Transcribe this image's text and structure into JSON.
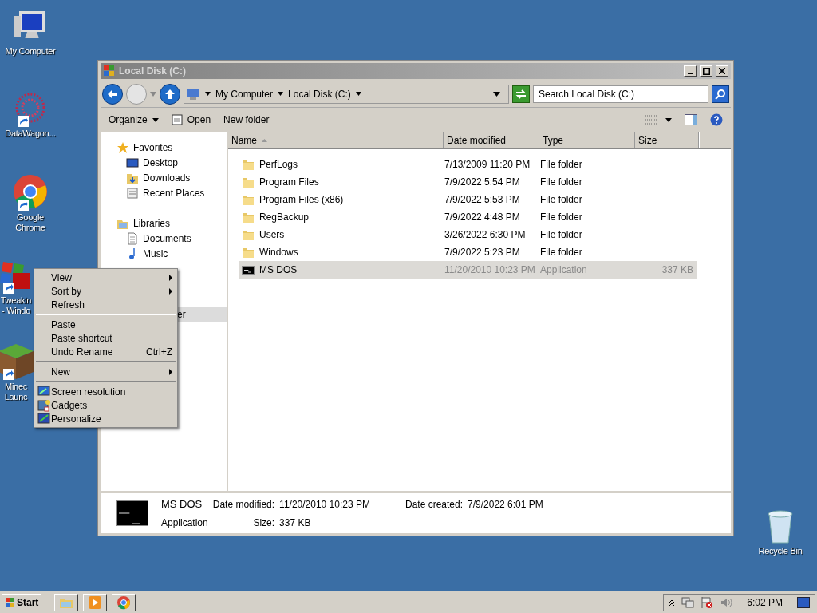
{
  "desktop_icons": [
    {
      "label": "My Computer",
      "kind": "computer",
      "shortcut": false
    },
    {
      "label": "DataWagon...",
      "kind": "datawagon",
      "shortcut": true
    },
    {
      "label": "Google Chrome",
      "kind": "chrome",
      "shortcut": true
    },
    {
      "label": "Tweakin\n- Windo",
      "kind": "tweaking",
      "shortcut": true
    },
    {
      "label": "Minec\nLaunc",
      "kind": "minecraft",
      "shortcut": true
    },
    {
      "label": "Recycle Bin",
      "kind": "recycle",
      "shortcut": false
    }
  ],
  "window": {
    "title": "Local Disk (C:)",
    "breadcrumbs": [
      "My Computer",
      "Local Disk (C:)"
    ],
    "search": {
      "placeholder": "Search Local Disk (C:)"
    },
    "toolbar": [
      {
        "label": "Organize",
        "kind": "dropdown"
      },
      {
        "label": "Open",
        "kind": "open"
      },
      {
        "label": "New folder",
        "kind": "plain"
      }
    ],
    "sidebar": [
      {
        "label": "Favorites",
        "kind": "favorites",
        "selected": false,
        "children": [
          {
            "label": "Desktop",
            "kind": "desktop",
            "selected": false
          },
          {
            "label": "Downloads",
            "kind": "downloads",
            "selected": false
          },
          {
            "label": "Recent Places",
            "kind": "recent",
            "selected": false
          }
        ]
      },
      {
        "label": "Libraries",
        "kind": "libraries",
        "selected": false,
        "children": [
          {
            "label": "Documents",
            "kind": "documents",
            "selected": false
          },
          {
            "label": "Music",
            "kind": "music",
            "selected": false
          }
        ]
      },
      {
        "label": "er",
        "kind": "none",
        "selected": true
      }
    ],
    "columns": [
      "Name",
      "Date modified",
      "Type",
      "Size"
    ],
    "rows": [
      {
        "name": "PerfLogs",
        "date": "7/13/2009 11:20 PM",
        "type": "File folder",
        "kind": "folder",
        "selected": false
      },
      {
        "name": "Program Files",
        "date": "7/9/2022 5:54 PM",
        "type": "File folder",
        "kind": "folder",
        "selected": false
      },
      {
        "name": "Program Files (x86)",
        "date": "7/9/2022 5:53 PM",
        "type": "File folder",
        "kind": "folder",
        "selected": false
      },
      {
        "name": "RegBackup",
        "date": "7/9/2022 4:48 PM",
        "type": "File folder",
        "kind": "folder",
        "selected": false
      },
      {
        "name": "Users",
        "date": "3/26/2022 6:30 PM",
        "type": "File folder",
        "kind": "folder",
        "selected": false
      },
      {
        "name": "Windows",
        "date": "7/9/2022 5:23 PM",
        "type": "File folder",
        "kind": "folder",
        "selected": false
      },
      {
        "name": "MS DOS",
        "date": "11/20/2010 10:23 PM",
        "type": "Application",
        "size": "337 KB",
        "kind": "app",
        "selected": true
      }
    ],
    "details": {
      "name": "MS DOS",
      "type": "Application",
      "modified_label": "Date modified:",
      "modified": "11/20/2010 10:23 PM",
      "size_label": "Size:",
      "size": "337 KB",
      "created_label": "Date created:",
      "created": "7/9/2022 6:01 PM"
    }
  },
  "context_menu": [
    {
      "kind": "item",
      "label": "View",
      "submenu": true
    },
    {
      "kind": "item",
      "label": "Sort by",
      "submenu": true
    },
    {
      "kind": "item",
      "label": "Refresh",
      "submenu": false
    },
    {
      "kind": "separator"
    },
    {
      "kind": "item",
      "label": "Paste",
      "submenu": false
    },
    {
      "kind": "item",
      "label": "Paste shortcut",
      "submenu": false
    },
    {
      "kind": "item",
      "label": "Undo Rename",
      "shortcut": "Ctrl+Z",
      "submenu": false
    },
    {
      "kind": "separator"
    },
    {
      "kind": "item",
      "label": "New",
      "submenu": true
    },
    {
      "kind": "separator"
    },
    {
      "kind": "icon_item",
      "label": "Screen resolution",
      "submenu": false
    },
    {
      "kind": "icon_item",
      "label": "Gadgets",
      "submenu": false
    },
    {
      "kind": "icon_item",
      "label": "Personalize",
      "submenu": false
    }
  ],
  "taskbar": {
    "start": "Start",
    "pinned": [
      {
        "kind": "explorer"
      },
      {
        "kind": "media"
      },
      {
        "kind": "chrome"
      }
    ],
    "clock": "6:02 PM"
  }
}
